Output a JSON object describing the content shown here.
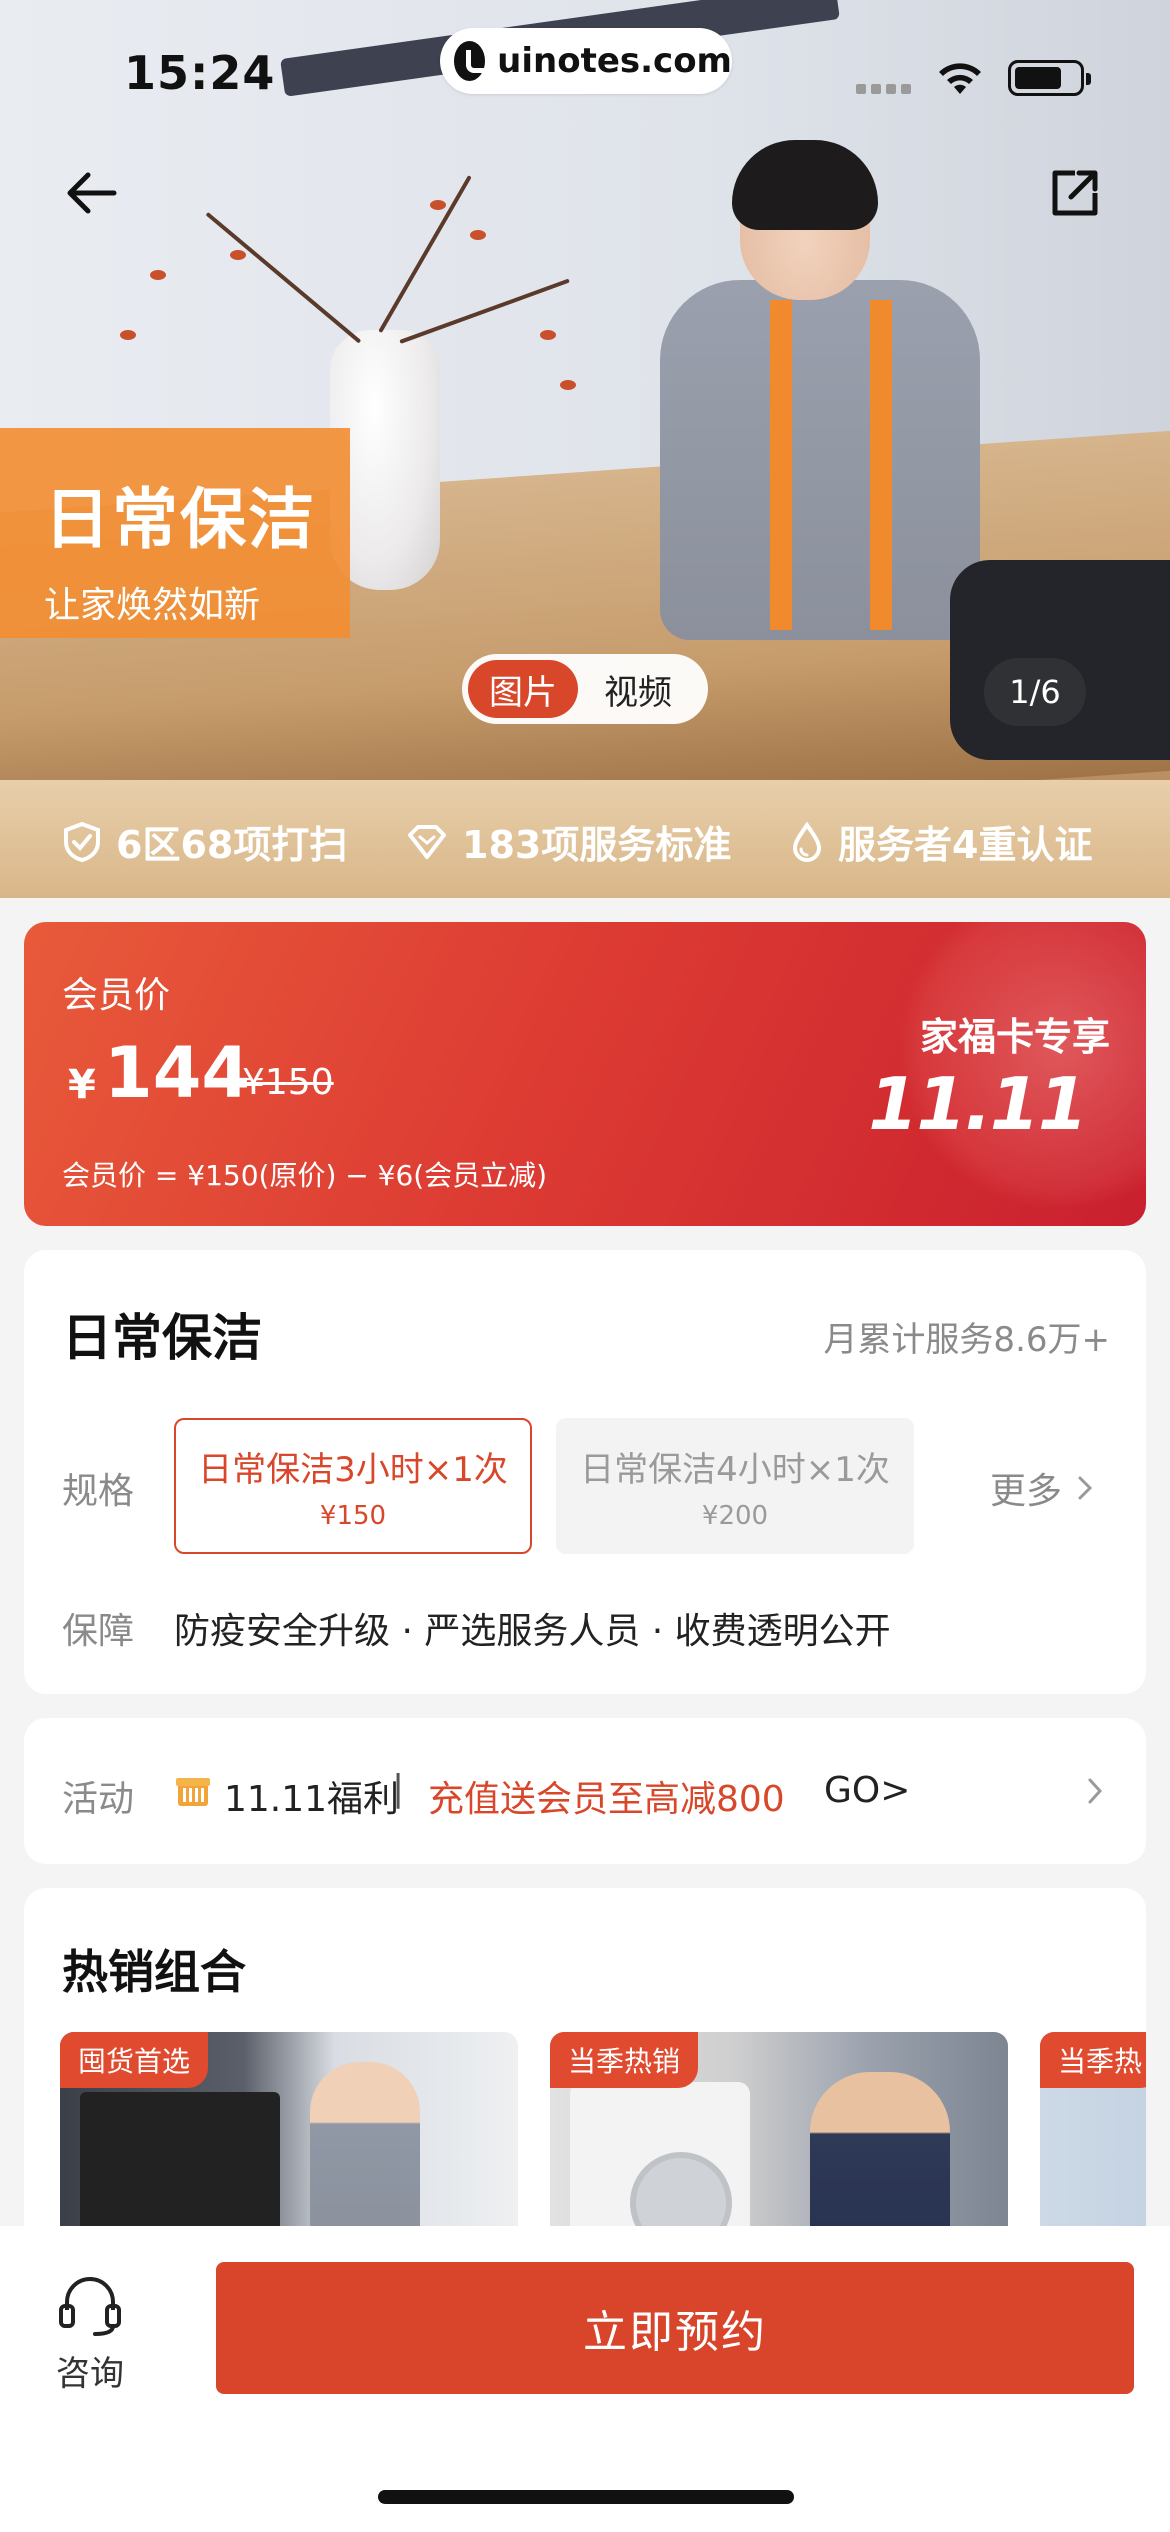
{
  "status_bar": {
    "time": "15:24",
    "site": "uinotes.com"
  },
  "hero": {
    "promo_title": "日常保洁",
    "promo_subtitle": "让家焕然如新",
    "tab_image": "图片",
    "tab_video": "视频",
    "page_indicator": "1/6"
  },
  "features": [
    {
      "icon": "shield-check-icon",
      "label": "6区68项打扫"
    },
    {
      "icon": "diamond-icon",
      "label": "183项服务标准"
    },
    {
      "icon": "drop-icon",
      "label": "服务者4重认证"
    }
  ],
  "price_card": {
    "label": "会员价",
    "currency": "¥",
    "price": "144",
    "original_price": "¥150",
    "formula": "会员价 = ¥150(原价) − ¥6(会员立减)",
    "exclusive": "家福卡专享",
    "event": "11.11"
  },
  "service": {
    "title": "日常保洁",
    "monthly_count": "月累计服务8.6万+",
    "spec_label": "规格",
    "options": [
      {
        "name": "日常保洁3小时×1次",
        "price": "¥150"
      },
      {
        "name": "日常保洁4小时×1次",
        "price": "¥200"
      }
    ],
    "more": "更多",
    "guarantee_label": "保障",
    "guarantee_text": "防疫安全升级 · 严选服务人员 · 收费透明公开"
  },
  "activity": {
    "label": "活动",
    "tag": "11.11福利",
    "separator": "|",
    "text": "充值送会员至高减800",
    "go": "GO>"
  },
  "combos": {
    "title": "热销组合",
    "items": [
      {
        "tag": "囤货首选"
      },
      {
        "tag": "当季热销"
      },
      {
        "tag": "当季热"
      }
    ]
  },
  "bottom_bar": {
    "consult": "咨询",
    "book": "立即预约"
  },
  "colors": {
    "accent": "#d9472b",
    "promo_orange": "#f28e34",
    "feature_gold": "#d9b689"
  }
}
